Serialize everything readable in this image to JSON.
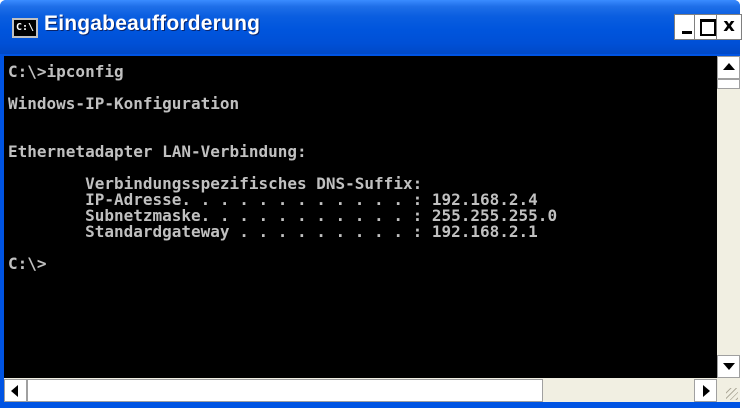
{
  "window": {
    "title": "Eingabeaufforderung",
    "icon_text": "C:\\",
    "icon": "console-icon",
    "accent_color": "#0054e3"
  },
  "console": {
    "lines": [
      "C:\\>ipconfig",
      "",
      "Windows-IP-Konfiguration",
      "",
      "",
      "Ethernetadapter LAN-Verbindung:",
      "",
      "        Verbindungsspezifisches DNS-Suffix:",
      "        IP-Adresse. . . . . . . . . . . . : 192.168.2.4",
      "        Subnetzmaske. . . . . . . . . . . : 255.255.255.0",
      "        Standardgateway . . . . . . . . . : 192.168.2.1",
      "",
      "C:\\>"
    ],
    "text_color": "#c0c0c0",
    "background": "#000000"
  },
  "controls": {
    "close_glyph": "x"
  }
}
